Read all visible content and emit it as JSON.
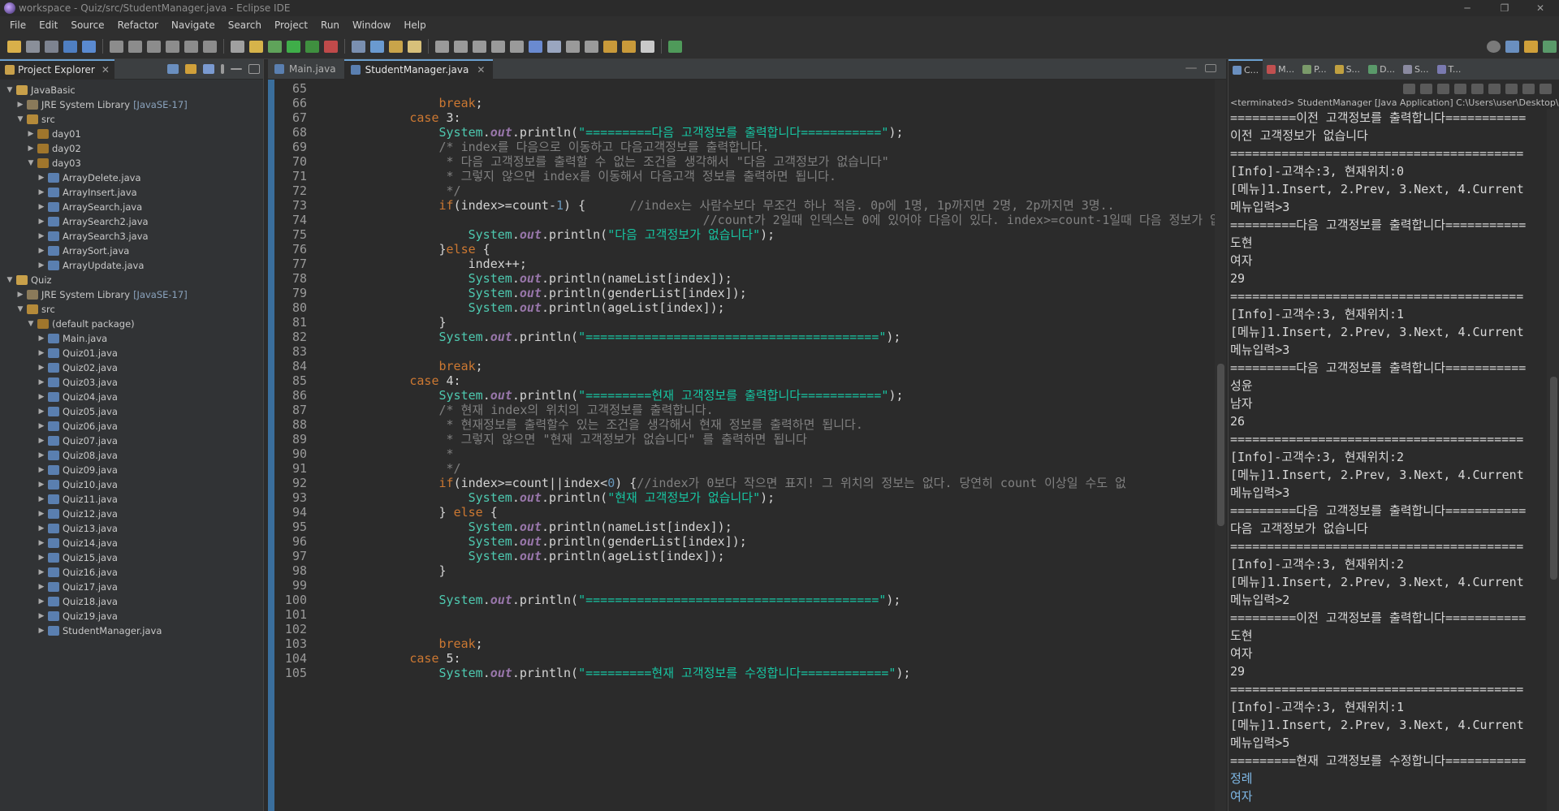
{
  "window": {
    "title": "workspace - Quiz/src/StudentManager.java - Eclipse IDE"
  },
  "menu": [
    "File",
    "Edit",
    "Source",
    "Refactor",
    "Navigate",
    "Search",
    "Project",
    "Run",
    "Window",
    "Help"
  ],
  "explorer": {
    "tab": "Project Explorer",
    "tree": [
      {
        "label": "JavaBasic",
        "type": "proj",
        "open": true
      },
      {
        "label": "JRE System Library",
        "extra": "[JavaSE-17]",
        "type": "lib",
        "open": false
      },
      {
        "label": "src",
        "type": "src",
        "open": true
      },
      {
        "label": "day01",
        "type": "pkg",
        "open": false
      },
      {
        "label": "day02",
        "type": "pkg",
        "open": false
      },
      {
        "label": "day03",
        "type": "pkg",
        "open": true
      },
      {
        "label": "ArrayDelete.java",
        "type": "java",
        "open": false
      },
      {
        "label": "ArrayInsert.java",
        "type": "java",
        "open": false
      },
      {
        "label": "ArraySearch.java",
        "type": "java",
        "open": false
      },
      {
        "label": "ArraySearch2.java",
        "type": "java",
        "open": false
      },
      {
        "label": "ArraySearch3.java",
        "type": "java",
        "open": false
      },
      {
        "label": "ArraySort.java",
        "type": "java",
        "open": false
      },
      {
        "label": "ArrayUpdate.java",
        "type": "java",
        "open": false
      },
      {
        "label": "Quiz",
        "type": "proj",
        "open": true
      },
      {
        "label": "JRE System Library",
        "extra": "[JavaSE-17]",
        "type": "lib",
        "open": false
      },
      {
        "label": "src",
        "type": "src",
        "open": true
      },
      {
        "label": "(default package)",
        "type": "pkg",
        "open": true
      },
      {
        "label": "Main.java",
        "type": "java",
        "open": false
      },
      {
        "label": "Quiz01.java",
        "type": "java",
        "open": false
      },
      {
        "label": "Quiz02.java",
        "type": "java",
        "open": false
      },
      {
        "label": "Quiz03.java",
        "type": "java",
        "open": false
      },
      {
        "label": "Quiz04.java",
        "type": "java",
        "open": false
      },
      {
        "label": "Quiz05.java",
        "type": "java",
        "open": false
      },
      {
        "label": "Quiz06.java",
        "type": "java",
        "open": false
      },
      {
        "label": "Quiz07.java",
        "type": "java",
        "open": false
      },
      {
        "label": "Quiz08.java",
        "type": "java",
        "open": false
      },
      {
        "label": "Quiz09.java",
        "type": "java",
        "open": false
      },
      {
        "label": "Quiz10.java",
        "type": "java",
        "open": false
      },
      {
        "label": "Quiz11.java",
        "type": "java",
        "open": false
      },
      {
        "label": "Quiz12.java",
        "type": "java",
        "open": false
      },
      {
        "label": "Quiz13.java",
        "type": "java",
        "open": false
      },
      {
        "label": "Quiz14.java",
        "type": "java",
        "open": false
      },
      {
        "label": "Quiz15.java",
        "type": "java",
        "open": false
      },
      {
        "label": "Quiz16.java",
        "type": "java",
        "open": false
      },
      {
        "label": "Quiz17.java",
        "type": "java",
        "open": false
      },
      {
        "label": "Quiz18.java",
        "type": "java",
        "open": false
      },
      {
        "label": "Quiz19.java",
        "type": "java",
        "open": false
      },
      {
        "label": "StudentManager.java",
        "type": "java",
        "open": false
      }
    ]
  },
  "editor": {
    "tabs": [
      {
        "label": "Main.java",
        "active": false
      },
      {
        "label": "StudentManager.java",
        "active": true
      }
    ],
    "lines": [
      {
        "n": "65",
        "t": ""
      },
      {
        "n": "66",
        "t": "\t\t\t\tbreak;"
      },
      {
        "n": "67",
        "t": "\t\t\tcase 3:"
      },
      {
        "n": "68",
        "t": "\t\t\t\tSystem.out.println(\"=========다음 고객정보를 출력합니다===========\");"
      },
      {
        "n": "69",
        "t": "\t\t\t\t/* index를 다음으로 이동하고 다음고객정보를 출력합니다."
      },
      {
        "n": "70",
        "t": "\t\t\t\t * 다음 고객정보를 출력할 수 없는 조건을 생각해서 \"다음 고객정보가 없습니다\""
      },
      {
        "n": "71",
        "t": "\t\t\t\t * 그렇지 않으면 index를 이동해서 다음고객 정보를 출력하면 됩니다."
      },
      {
        "n": "72",
        "t": "\t\t\t\t */"
      },
      {
        "n": "73",
        "t": "\t\t\t\tif(index>=count-1) {      //index는 사람수보다 무조건 하나 적음. 0p에 1명, 1p까지면 2명, 2p까지면 3명.."
      },
      {
        "n": "74",
        "t": "\t\t\t\t\t\t\t\t\t\t\t\t\t//count가 2일때 인덱스는 0에 있어야 다음이 있다. index>=count-1일때 다음 정보가 없"
      },
      {
        "n": "75",
        "t": "\t\t\t\t\tSystem.out.println(\"다음 고객정보가 없습니다\");"
      },
      {
        "n": "76",
        "t": "\t\t\t\t}else {"
      },
      {
        "n": "77",
        "t": "\t\t\t\t\tindex++;"
      },
      {
        "n": "78",
        "t": "\t\t\t\t\tSystem.out.println(nameList[index]);"
      },
      {
        "n": "79",
        "t": "\t\t\t\t\tSystem.out.println(genderList[index]);"
      },
      {
        "n": "80",
        "t": "\t\t\t\t\tSystem.out.println(ageList[index]);"
      },
      {
        "n": "81",
        "t": "\t\t\t\t}"
      },
      {
        "n": "82",
        "t": "\t\t\t\tSystem.out.println(\"========================================\");"
      },
      {
        "n": "83",
        "t": ""
      },
      {
        "n": "84",
        "t": "\t\t\t\tbreak;"
      },
      {
        "n": "85",
        "t": "\t\t\tcase 4:"
      },
      {
        "n": "86",
        "t": "\t\t\t\tSystem.out.println(\"=========현재 고객정보를 출력합니다===========\");"
      },
      {
        "n": "87",
        "t": "\t\t\t\t/* 현재 index의 위치의 고객정보를 출력합니다."
      },
      {
        "n": "88",
        "t": "\t\t\t\t * 현재정보를 출력할수 있는 조건을 생각해서 현재 정보를 출력하면 됩니다."
      },
      {
        "n": "89",
        "t": "\t\t\t\t * 그렇지 않으면 \"현재 고객정보가 없습니다\" 를 출력하면 됩니다"
      },
      {
        "n": "90",
        "t": "\t\t\t\t *"
      },
      {
        "n": "91",
        "t": "\t\t\t\t */"
      },
      {
        "n": "92",
        "t": "\t\t\t\tif(index>=count||index<0) {//index가 0보다 작으면 표지! 그 위치의 정보는 없다. 당연히 count 이상일 수도 없"
      },
      {
        "n": "93",
        "t": "\t\t\t\t\tSystem.out.println(\"현재 고객정보가 없습니다\");"
      },
      {
        "n": "94",
        "t": "\t\t\t\t} else {"
      },
      {
        "n": "95",
        "t": "\t\t\t\t\tSystem.out.println(nameList[index]);"
      },
      {
        "n": "96",
        "t": "\t\t\t\t\tSystem.out.println(genderList[index]);"
      },
      {
        "n": "97",
        "t": "\t\t\t\t\tSystem.out.println(ageList[index]);"
      },
      {
        "n": "98",
        "t": "\t\t\t\t}"
      },
      {
        "n": "99",
        "t": ""
      },
      {
        "n": "100",
        "t": "\t\t\t\tSystem.out.println(\"========================================\");"
      },
      {
        "n": "101",
        "t": ""
      },
      {
        "n": "102",
        "t": ""
      },
      {
        "n": "103",
        "t": "\t\t\t\tbreak;"
      },
      {
        "n": "104",
        "t": "\t\t\tcase 5:"
      },
      {
        "n": "105",
        "t": "\t\t\t\tSystem.out.println(\"=========현재 고객정보를 수정합니다============\");"
      }
    ]
  },
  "console": {
    "tabs": [
      "C...",
      "M...",
      "P...",
      "S...",
      "D...",
      "S...",
      "T..."
    ],
    "status": "<terminated> StudentManager [Java Application] C:\\Users\\user\\Desktop\\",
    "lines": [
      {
        "t": "=========이전 고객정보를 출력합니다===========",
        "in": false
      },
      {
        "t": "이전 고객정보가 없습니다",
        "in": false
      },
      {
        "t": "========================================",
        "in": false
      },
      {
        "t": "[Info]-고객수:3, 현재위치:0",
        "in": false
      },
      {
        "t": "[메뉴]1.Insert, 2.Prev, 3.Next, 4.Current",
        "in": false
      },
      {
        "t": "메뉴입력>3",
        "in": false
      },
      {
        "t": "=========다음 고객정보를 출력합니다===========",
        "in": false
      },
      {
        "t": "도현",
        "in": false
      },
      {
        "t": "여자",
        "in": false
      },
      {
        "t": "29",
        "in": false
      },
      {
        "t": "========================================",
        "in": false
      },
      {
        "t": "[Info]-고객수:3, 현재위치:1",
        "in": false
      },
      {
        "t": "[메뉴]1.Insert, 2.Prev, 3.Next, 4.Current",
        "in": false
      },
      {
        "t": "메뉴입력>3",
        "in": false
      },
      {
        "t": "=========다음 고객정보를 출력합니다===========",
        "in": false
      },
      {
        "t": "성윤",
        "in": false
      },
      {
        "t": "남자",
        "in": false
      },
      {
        "t": "26",
        "in": false
      },
      {
        "t": "========================================",
        "in": false
      },
      {
        "t": "[Info]-고객수:3, 현재위치:2",
        "in": false
      },
      {
        "t": "[메뉴]1.Insert, 2.Prev, 3.Next, 4.Current",
        "in": false
      },
      {
        "t": "메뉴입력>3",
        "in": false
      },
      {
        "t": "=========다음 고객정보를 출력합니다===========",
        "in": false
      },
      {
        "t": "다음 고객정보가 없습니다",
        "in": false
      },
      {
        "t": "========================================",
        "in": false
      },
      {
        "t": "[Info]-고객수:3, 현재위치:2",
        "in": false
      },
      {
        "t": "[메뉴]1.Insert, 2.Prev, 3.Next, 4.Current",
        "in": false
      },
      {
        "t": "메뉴입력>2",
        "in": false
      },
      {
        "t": "=========이전 고객정보를 출력합니다===========",
        "in": false
      },
      {
        "t": "도현",
        "in": false
      },
      {
        "t": "여자",
        "in": false
      },
      {
        "t": "29",
        "in": false
      },
      {
        "t": "========================================",
        "in": false
      },
      {
        "t": "[Info]-고객수:3, 현재위치:1",
        "in": false
      },
      {
        "t": "[메뉴]1.Insert, 2.Prev, 3.Next, 4.Current",
        "in": false
      },
      {
        "t": "메뉴입력>5",
        "in": false
      },
      {
        "t": "=========현재 고객정보를 수정합니다===========",
        "in": false
      },
      {
        "t": "정례",
        "in": true
      },
      {
        "t": "여자",
        "in": true
      }
    ]
  }
}
